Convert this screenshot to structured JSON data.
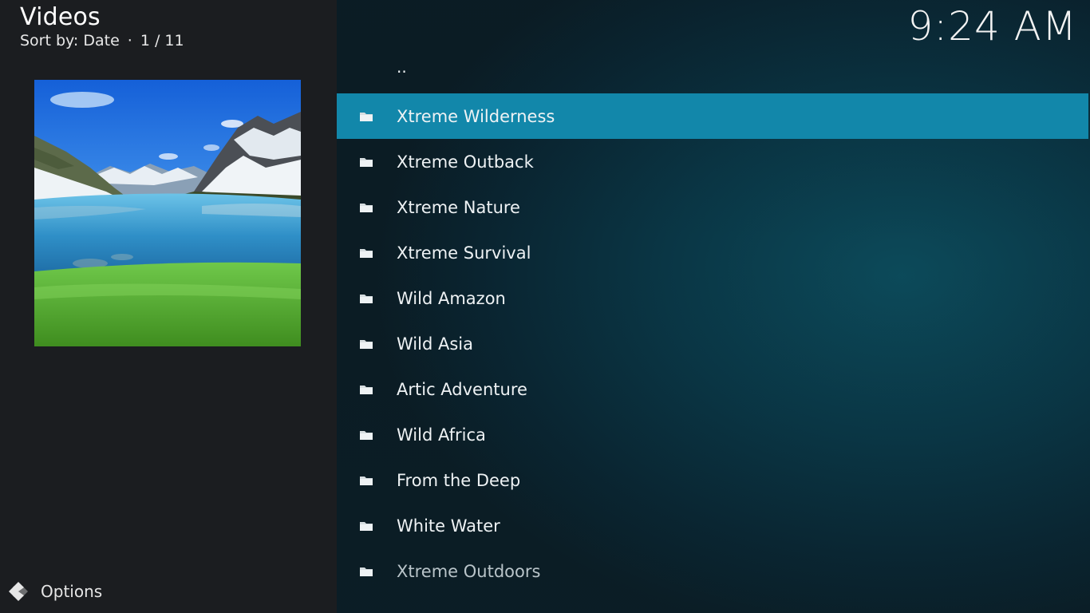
{
  "header": {
    "title": "Videos",
    "sort_label": "Sort by: Date",
    "separator": "·",
    "position": "1 / 11"
  },
  "clock": "9:24 AM",
  "options": {
    "label": "Options",
    "icon": "options-icon"
  },
  "list": {
    "parent": "..",
    "items": [
      {
        "label": "Xtreme Wilderness",
        "icon": "folder-icon",
        "selected": true
      },
      {
        "label": "Xtreme Outback",
        "icon": "folder-icon"
      },
      {
        "label": "Xtreme Nature",
        "icon": "folder-icon"
      },
      {
        "label": "Xtreme Survival",
        "icon": "folder-icon"
      },
      {
        "label": "Wild Amazon",
        "icon": "folder-icon"
      },
      {
        "label": "Wild Asia",
        "icon": "folder-icon"
      },
      {
        "label": "Artic Adventure",
        "icon": "folder-icon"
      },
      {
        "label": "Wild Africa",
        "icon": "folder-icon"
      },
      {
        "label": "From the Deep",
        "icon": "folder-icon"
      },
      {
        "label": "White Water",
        "icon": "folder-icon"
      },
      {
        "label": "Xtreme Outdoors",
        "icon": "folder-icon"
      }
    ]
  },
  "colors": {
    "selected_row": "#1287aa",
    "left_panel": "#1b1d20",
    "right_panel": "#0a3645"
  }
}
